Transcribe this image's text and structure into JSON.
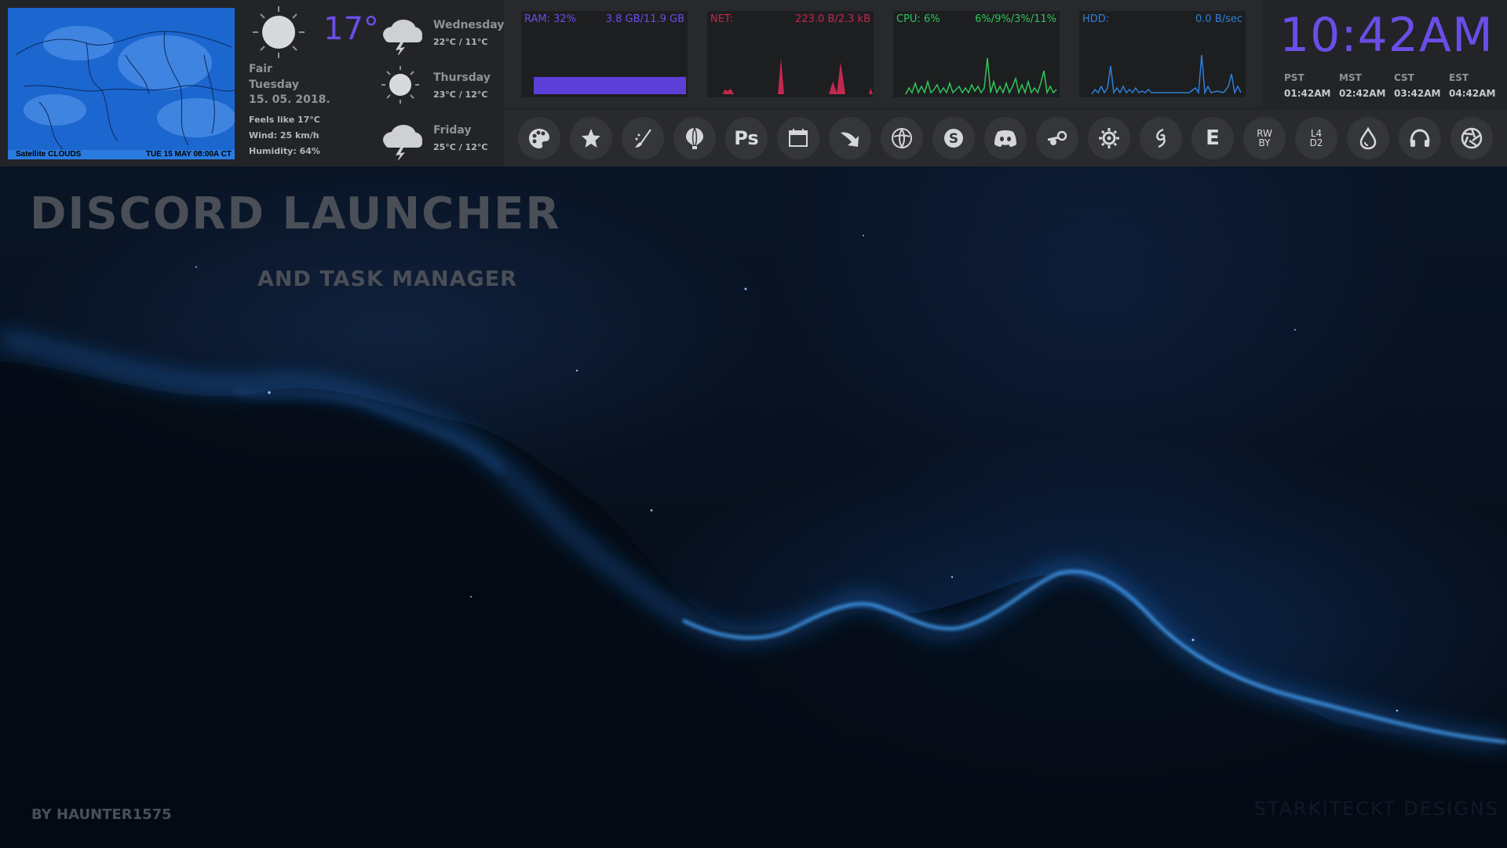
{
  "satellite": {
    "caption_left": "Satellite CLOUDS",
    "caption_right": "TUE 15 MAY   08:00A CT"
  },
  "weather": {
    "current": {
      "temperature": "17°",
      "condition": "Fair",
      "day": "Tuesday",
      "date": "15. 05. 2018.",
      "feels_like": "Feels like 17°C",
      "wind": "Wind: 25 km/h",
      "humidity": "Humidity: 64%",
      "icon": "sun-icon"
    },
    "forecast": [
      {
        "day": "Wednesday",
        "temps": "22°C / 11°C",
        "icon": "storm-cloud-icon"
      },
      {
        "day": "Thursday",
        "temps": "23°C / 12°C",
        "icon": "sun-icon"
      },
      {
        "day": "Friday",
        "temps": "25°C / 12°C",
        "icon": "storm-cloud-icon"
      }
    ]
  },
  "monitors": {
    "ram": {
      "label": "RAM: 32%",
      "value": "3.8 GB/11.9 GB",
      "color": "#6b4de8",
      "usage_percent": 32
    },
    "net": {
      "label": "NET:",
      "value": "223.0 B/2.3 kB",
      "color": "#c2284f"
    },
    "cpu": {
      "label": "CPU: 6%",
      "value": "6%/9%/3%/11%",
      "color": "#2fc45a"
    },
    "hdd": {
      "label": "HDD:",
      "value": "0.0 B/sec",
      "color": "#2e7fd8"
    }
  },
  "dock": {
    "icons": [
      {
        "name": "palette-icon"
      },
      {
        "name": "star-icon"
      },
      {
        "name": "brush-icon"
      },
      {
        "name": "balloon-icon"
      },
      {
        "name": "photoshop-icon",
        "text": "Ps"
      },
      {
        "name": "calendar-icon"
      },
      {
        "name": "swoosh-icon"
      },
      {
        "name": "browser-icon"
      },
      {
        "name": "skype-icon"
      },
      {
        "name": "discord-icon"
      },
      {
        "name": "steam-icon"
      },
      {
        "name": "gear-sun-icon"
      },
      {
        "name": "spiral-icon"
      },
      {
        "name": "epic-icon",
        "text": "E"
      },
      {
        "name": "rwby-icon",
        "text": "RW\nBY"
      },
      {
        "name": "l4d2-icon",
        "text": "L4\nD2"
      },
      {
        "name": "drop-icon"
      },
      {
        "name": "headphones-icon"
      },
      {
        "name": "aperture-icon"
      }
    ]
  },
  "clock": {
    "time": "10:42AM",
    "zones": [
      {
        "name": "PST",
        "time": "01:42AM"
      },
      {
        "name": "MST",
        "time": "02:42AM"
      },
      {
        "name": "CST",
        "time": "03:42AM"
      },
      {
        "name": "EST",
        "time": "04:42AM"
      }
    ],
    "color": "#6b4de8"
  },
  "wallpaper": {
    "title": "DISCORD LAUNCHER",
    "subtitle": "AND TASK MANAGER",
    "byline": "BY HAUNTER1575",
    "watermark": "STARKITECKT DESIGNS"
  }
}
